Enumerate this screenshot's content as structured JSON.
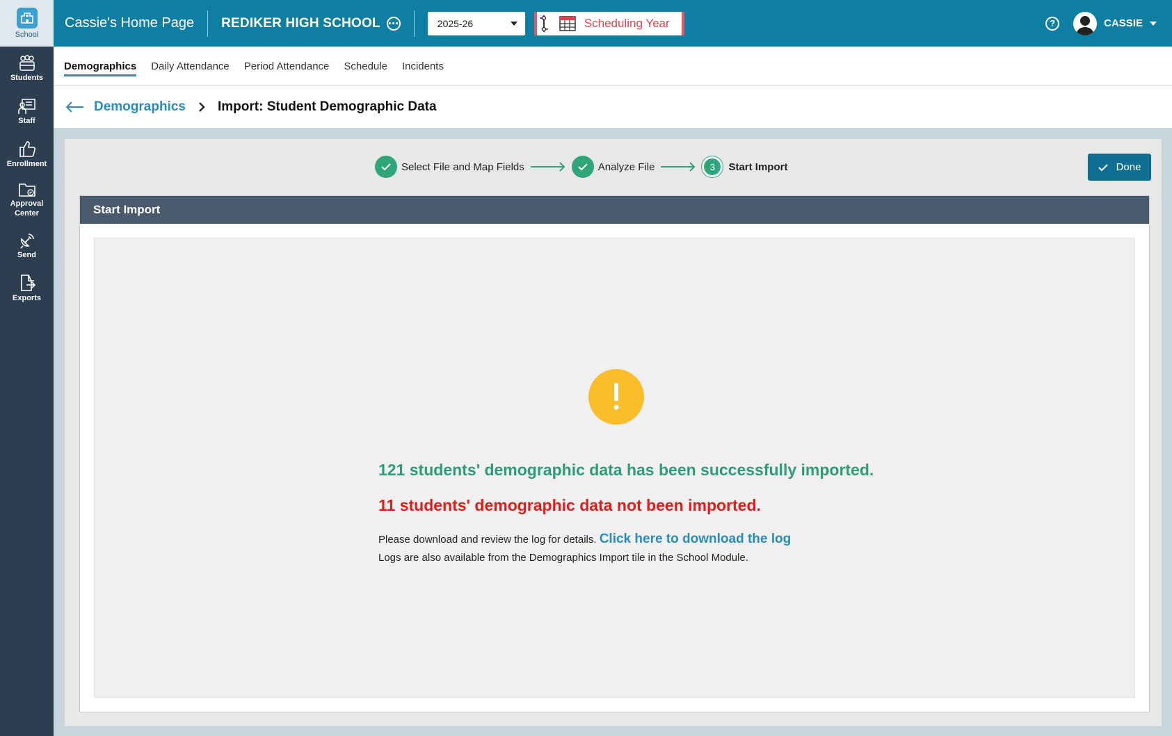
{
  "nav": {
    "items": [
      {
        "label": "School",
        "icon": "school-icon"
      },
      {
        "label": "Students",
        "icon": "students-icon"
      },
      {
        "label": "Staff",
        "icon": "staff-icon"
      },
      {
        "label": "Enrollment",
        "icon": "thumbs-up-icon"
      },
      {
        "label": "Approval",
        "label2": "Center",
        "icon": "folder-icon"
      },
      {
        "label": "Send",
        "icon": "satellite-icon"
      },
      {
        "label": "Exports",
        "icon": "export-icon"
      }
    ]
  },
  "header": {
    "home_title": "Cassie's Home Page",
    "school_name": "REDIKER HIGH SCHOOL",
    "year": "2025-26",
    "scheduling_label": "Scheduling Year",
    "user": "CASSIE",
    "help": "?"
  },
  "tabs": [
    {
      "label": "Demographics",
      "active": true
    },
    {
      "label": "Daily Attendance"
    },
    {
      "label": "Period Attendance"
    },
    {
      "label": "Schedule"
    },
    {
      "label": "Incidents"
    }
  ],
  "breadcrumb": {
    "parent": "Demographics",
    "current": "Import: Student Demographic Data"
  },
  "stepper": {
    "step1": "Select File and Map Fields",
    "step2": "Analyze File",
    "step3_number": "3",
    "step3": "Start Import"
  },
  "done_label": "Done",
  "panel": {
    "title": "Start Import",
    "success_msg": "121 students' demographic data has been successfully imported.",
    "fail_msg": "11 students' demographic data not been imported.",
    "info_prefix": "Please download and review the log for details.",
    "download_link": "Click here to download the log",
    "info2": "Logs are also available from the Demographics Import tile in the School Module."
  },
  "colors": {
    "primary": "#0f7ea3",
    "nav_bg": "#2c3e4f",
    "success": "#2e9d74",
    "error": "#e41b1b",
    "warning": "#fbbd2a",
    "link": "#2a8bbd"
  }
}
